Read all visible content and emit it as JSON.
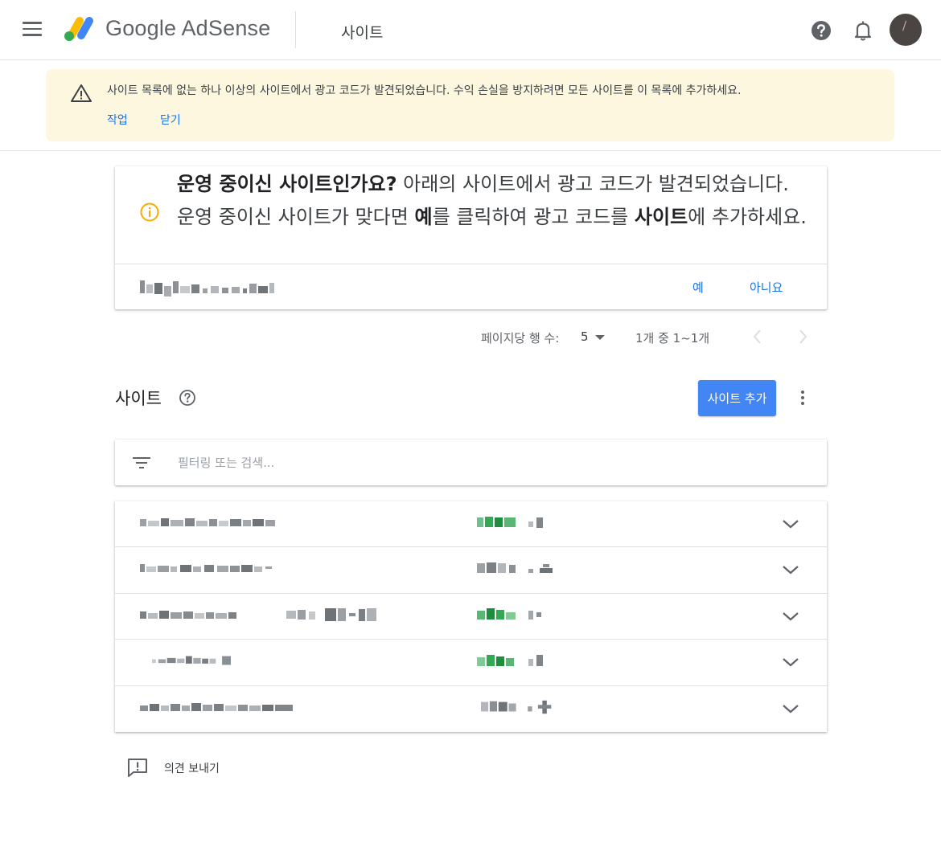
{
  "header": {
    "brand": "Google AdSense",
    "section": "사이트"
  },
  "banner": {
    "message": "사이트 목록에 없는 하나 이상의 사이트에서 광고 코드가 발견되었습니다. 수익 손실을 방지하려면 모든 사이트를 이 목록에 추가하세요.",
    "action_label": "작업",
    "close_label": "닫기"
  },
  "info_card": {
    "heading": "운영 중이신 사이트인가요?",
    "text_1": " 아래의 사이트에서 광고 코드가 발견되었습니다. 운영 중이신 사이트가 맞다면 ",
    "bold_yes": "예",
    "text_2": "를 클릭하여 광고 코드를 ",
    "bold_site": "사이트",
    "text_3": "에 추가하세요.",
    "yes_label": "예",
    "no_label": "아니요"
  },
  "pagination": {
    "rows_per_page_label": "페이지당 행 수:",
    "rows_per_page_value": "5",
    "range": "1개 중 1~1개"
  },
  "sites": {
    "title": "사이트",
    "add_button": "사이트 추가",
    "filter_placeholder": "필터링 또는 검색...",
    "row_count": 5
  },
  "feedback": {
    "label": "의견 보내기"
  },
  "colors": {
    "brand_blue": "#4285f4",
    "link_blue": "#1a73e8",
    "banner_bg": "#fef7e0",
    "info_orange": "#f9ab00",
    "status_green": "#34a853"
  },
  "icons": [
    "menu-icon",
    "adsense-logo-icon",
    "help-icon",
    "bell-icon",
    "warning-icon",
    "info-icon",
    "caret-down-icon",
    "chevron-left-icon",
    "chevron-right-icon",
    "filter-icon",
    "more-vert-icon",
    "chevron-down-icon",
    "feedback-icon"
  ]
}
